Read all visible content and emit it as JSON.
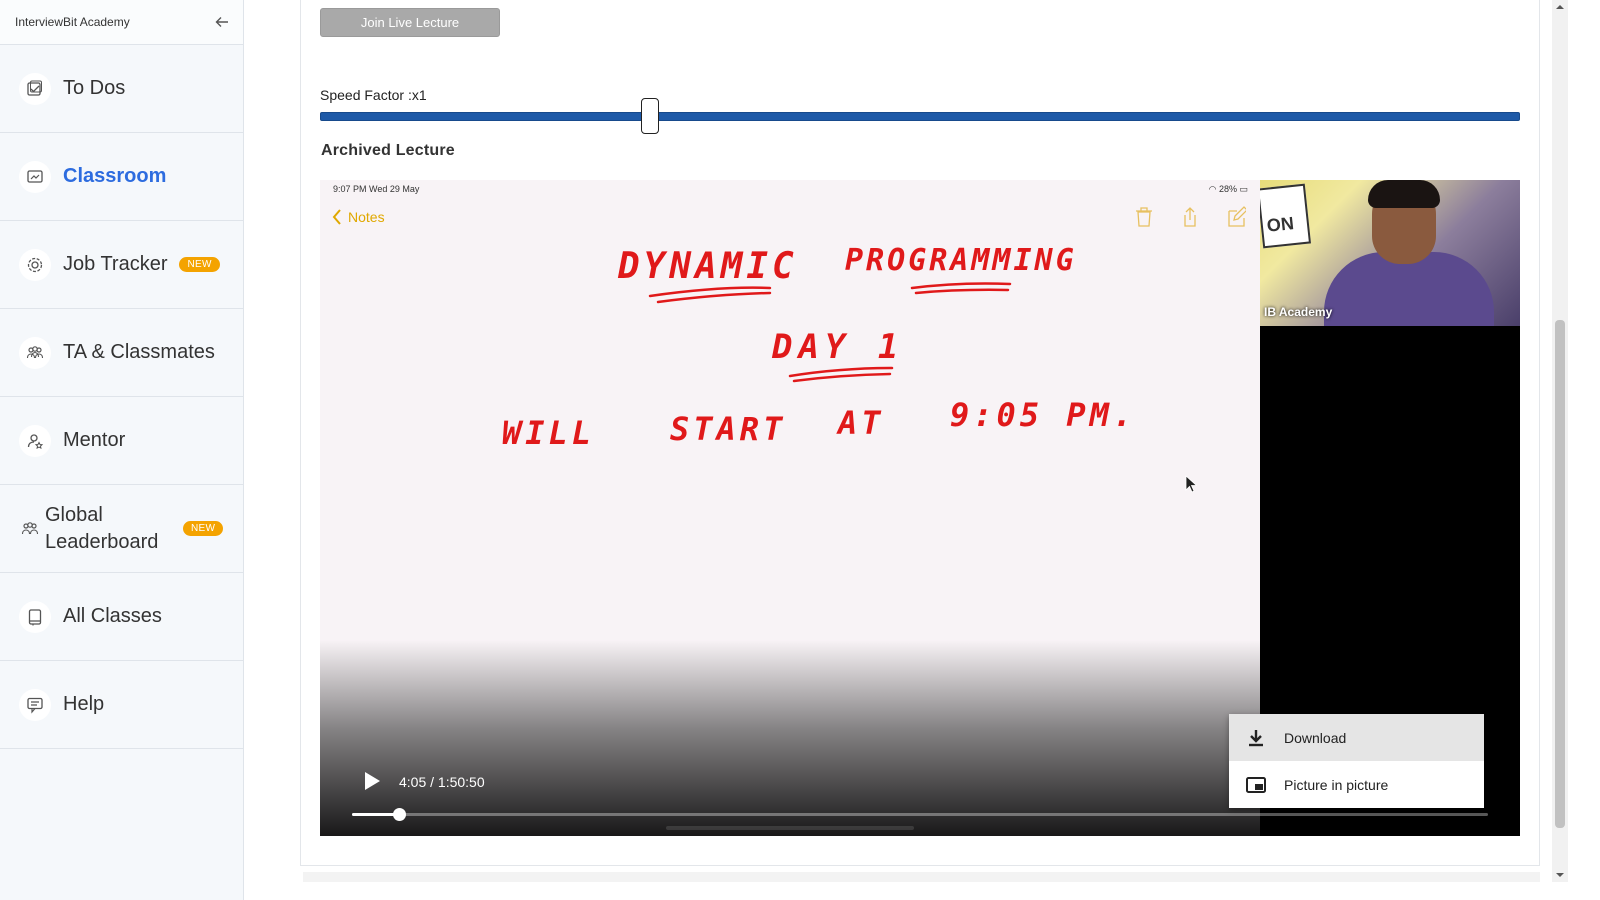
{
  "sidebar": {
    "brand": "InterviewBit Academy",
    "items": [
      {
        "label": "To Dos",
        "icon": "todo-icon"
      },
      {
        "label": "Classroom",
        "icon": "classroom-icon",
        "active": true
      },
      {
        "label": "Job Tracker",
        "icon": "gear-icon",
        "badge": "NEW"
      },
      {
        "label": "TA & Classmates",
        "icon": "people-icon"
      },
      {
        "label": "Mentor",
        "icon": "mentor-icon"
      },
      {
        "label": "Global Leaderboard",
        "icon": "leaderboard-icon",
        "badge": "NEW"
      },
      {
        "label": "All Classes",
        "icon": "book-icon"
      },
      {
        "label": "Help",
        "icon": "help-icon"
      }
    ]
  },
  "main": {
    "join_button": "Join Live Lecture",
    "speed_label": "Speed Factor :x1",
    "speed_fraction": 0.275,
    "archived_heading": "Archived Lecture"
  },
  "video": {
    "ipad_time": "9:07 PM   Wed 29 May",
    "ipad_battery": "28%",
    "notes_back": "Notes",
    "handwriting": {
      "line1a": "DYNAMIC",
      "line1b": "PROGRAMMING",
      "line2": "DAY 1",
      "line3": [
        "WILL",
        "START",
        "AT",
        "9:05 PM."
      ]
    },
    "cam_label": "IB Academy",
    "cam_sign": "ON",
    "time_display": "4:05 / 1:50:50",
    "progress_fraction": 0.041,
    "menu": {
      "download": "Download",
      "pip": "Picture in picture"
    }
  },
  "colors": {
    "accent": "#2d6cdf",
    "badge": "#f4a300",
    "slider": "#1e5aa8",
    "ink": "#e0191a"
  }
}
